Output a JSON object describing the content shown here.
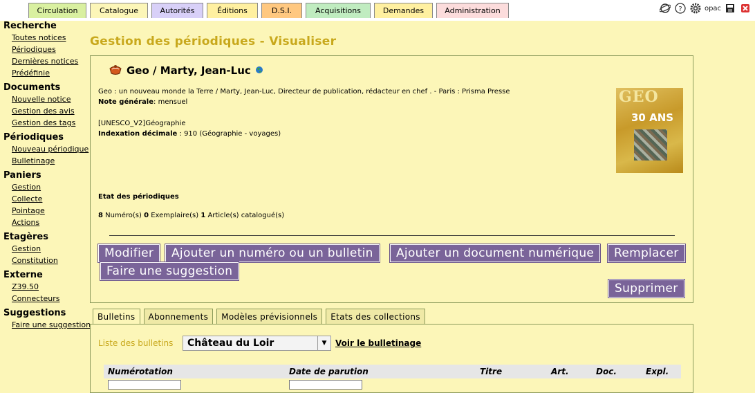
{
  "tabs": [
    {
      "label": "Circulation",
      "color": "#d9f0a0"
    },
    {
      "label": "Catalogue",
      "color": "#fcf6b8"
    },
    {
      "label": "Autorités",
      "color": "#d8d0f8"
    },
    {
      "label": "Éditions",
      "color": "#fff0a0"
    },
    {
      "label": "D.S.I.",
      "color": "#ffc880"
    },
    {
      "label": "Acquisitions",
      "color": "#c0ecc0"
    },
    {
      "label": "Demandes",
      "color": "#fff0a0"
    },
    {
      "label": "Administration",
      "color": "#fcdcdc"
    }
  ],
  "top_icons": [
    "planet-icon",
    "help-icon",
    "gear-icon",
    "opac-icon",
    "save-icon",
    "close-icon"
  ],
  "top_icons_opac_label": "opac",
  "sidebar": {
    "sections": [
      {
        "title": "Recherche",
        "items": [
          "Toutes notices",
          "Périodiques",
          "Dernières notices",
          "Prédéfinie"
        ]
      },
      {
        "title": "Documents",
        "items": [
          "Nouvelle notice",
          "Gestion des avis",
          "Gestion des tags"
        ]
      },
      {
        "title": "Périodiques",
        "items": [
          "Nouveau périodique",
          "Bulletinage"
        ]
      },
      {
        "title": "Paniers",
        "items": [
          "Gestion",
          "Collecte",
          "Pointage",
          "Actions"
        ]
      },
      {
        "title": "Etagères",
        "items": [
          "Gestion",
          "Constitution"
        ]
      },
      {
        "title": "Externe",
        "items": [
          "Z39.50",
          "Connecteurs"
        ]
      },
      {
        "title": "Suggestions",
        "items": [
          "Faire une suggestion"
        ]
      }
    ]
  },
  "page_title": "Gestion des périodiques - Visualiser",
  "notice": {
    "title": "Geo / Marty, Jean-Luc",
    "description": "Geo : un nouveau monde la Terre / Marty, Jean-Luc, Directeur de publication, rédacteur en chef . - Paris : Prisma Presse",
    "note_label": "Note générale",
    "note_value": ": mensuel",
    "subject": "[UNESCO_V2]Géographie",
    "indexation_label": "Indexation décimale",
    "indexation_value": " : 910 (Géographie - voyages)",
    "etat_label": "Etat des périodiques",
    "count_numeros": "8",
    "label_numeros": " Numéro(s) ",
    "count_exemplaires": "0",
    "label_exemplaires": " Exemplaire(s) ",
    "count_articles": "1",
    "label_articles": " Article(s) catalogué(s)",
    "cover_title": "GEO",
    "cover_badge": "30 ANS"
  },
  "buttons": {
    "modifier": "Modifier",
    "ajouter_numero": "Ajouter un numéro ou un bulletin",
    "ajouter_document": "Ajouter un document numérique",
    "remplacer": "Remplacer",
    "suggestion": "Faire une suggestion",
    "supprimer": "Supprimer"
  },
  "content_tabs": [
    "Bulletins",
    "Abonnements",
    "Modèles prévisionnels",
    "Etats des collections"
  ],
  "bulletins": {
    "list_label": "Liste des bulletins",
    "selected": "Château du Loir",
    "voir_link": "Voir le bulletinage",
    "columns": [
      "Numérotation",
      "Date de parution",
      "Titre",
      "Art.",
      "Doc.",
      "Expl."
    ]
  }
}
